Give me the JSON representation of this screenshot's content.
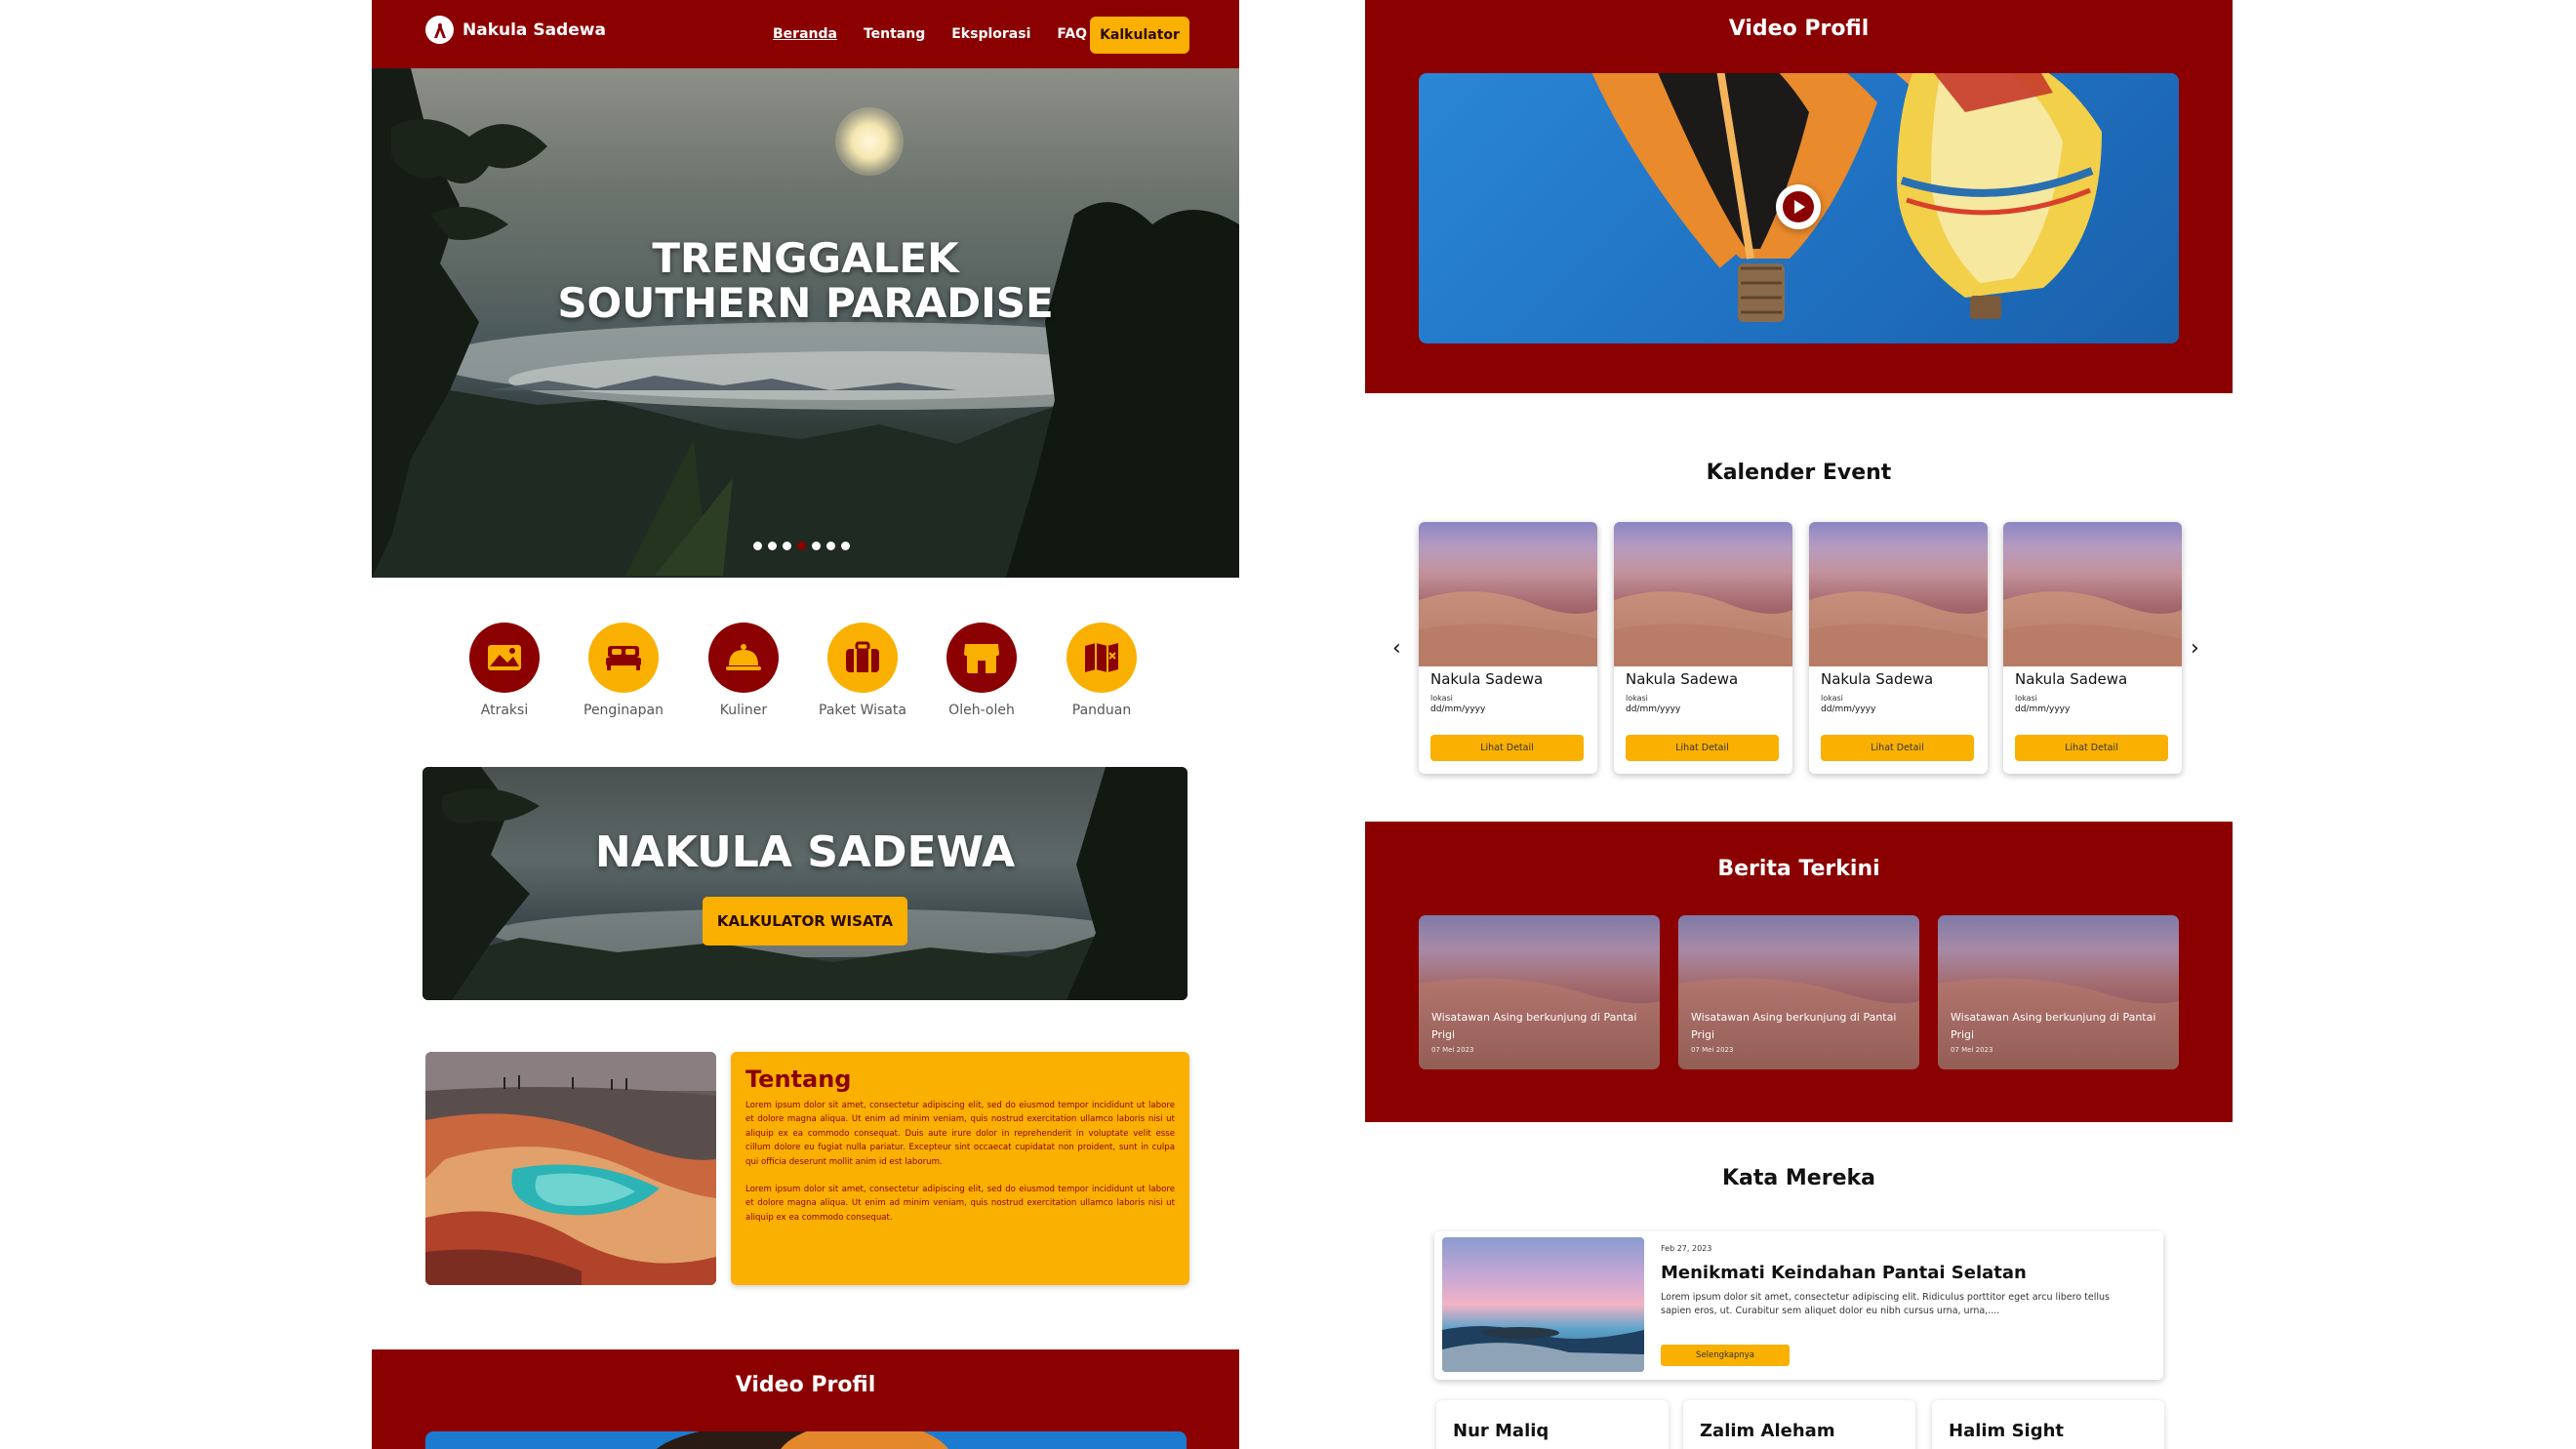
{
  "navbar": {
    "brand": "Nakula Sadewa",
    "links": [
      "Beranda",
      "Tentang",
      "Eksplorasi",
      "FAQ"
    ],
    "cta": "Kalkulator"
  },
  "hero": {
    "title_line1": "TRENGGALEK",
    "title_line2": "SOUTHERN PARADISE",
    "slide_count": 7,
    "active_slide": 4
  },
  "categories": [
    {
      "label": "Atraksi",
      "icon": "map-landscape-icon",
      "color": "red"
    },
    {
      "label": "Penginapan",
      "icon": "bed-icon",
      "color": "yellow"
    },
    {
      "label": "Kuliner",
      "icon": "food-cloche-icon",
      "color": "red"
    },
    {
      "label": "Paket Wisata",
      "icon": "suitcase-icon",
      "color": "yellow"
    },
    {
      "label": "Oleh-oleh",
      "icon": "shop-icon",
      "color": "red"
    },
    {
      "label": "Panduan",
      "icon": "folded-map-icon",
      "color": "yellow"
    }
  ],
  "banner": {
    "title": "NAKULA SADEWA",
    "button": "KALKULATOR WISATA"
  },
  "about": {
    "title": "Tentang",
    "paragraph1": "Lorem ipsum dolor sit amet, consectetur adipiscing elit, sed do eiusmod tempor incididunt ut labore et dolore magna aliqua. Ut enim ad minim veniam, quis nostrud exercitation ullamco laboris nisi ut aliquip ex ea commodo consequat. Duis aute irure dolor in reprehenderit in voluptate velit esse cillum dolore eu fugiat nulla pariatur. Excepteur sint occaecat cupidatat non proident, sunt in culpa qui officia deserunt mollit anim id est laborum.",
    "paragraph2": "Lorem ipsum dolor sit amet, consectetur adipiscing elit, sed do eiusmod tempor incididunt ut labore et dolore magna aliqua. Ut enim ad minim veniam, quis nostrud exercitation ullamco laboris nisi ut aliquip ex ea commodo consequat."
  },
  "video": {
    "title": "Video Profil"
  },
  "events": {
    "title": "Kalender Event",
    "cards": [
      {
        "name": "Nakula Sadewa",
        "location": "lokasi",
        "date": "dd/mm/yyyy",
        "button": "Lihat Detail"
      },
      {
        "name": "Nakula Sadewa",
        "location": "lokasi",
        "date": "dd/mm/yyyy",
        "button": "Lihat Detail"
      },
      {
        "name": "Nakula Sadewa",
        "location": "lokasi",
        "date": "dd/mm/yyyy",
        "button": "Lihat Detail"
      },
      {
        "name": "Nakula Sadewa",
        "location": "lokasi",
        "date": "dd/mm/yyyy",
        "button": "Lihat Detail"
      }
    ],
    "prev": "‹",
    "next": "›"
  },
  "news": {
    "title": "Berita Terkini",
    "cards": [
      {
        "headline": "Wisatawan Asing berkunjung di Pantai Prigi",
        "date": "07 Mei 2023"
      },
      {
        "headline": "Wisatawan Asing berkunjung di Pantai Prigi",
        "date": "07 Mei 2023"
      },
      {
        "headline": "Wisatawan Asing berkunjung di Pantai Prigi",
        "date": "07 Mei 2023"
      }
    ]
  },
  "testimonials": {
    "title": "Kata Mereka",
    "featured": {
      "date": "Feb 27, 2023",
      "title": "Menikmati Keindahan Pantai Selatan",
      "body": "Lorem ipsum dolor sit amet, consectetur adipiscing elit. Ridiculus porttitor eget arcu libero tellus sapien eros, ut. Curabitur sem aliquet dolor eu nibh cursus urna, urna,....",
      "button": "Selengkapnya"
    },
    "people": [
      "Nur Maliq",
      "Zalim Aleham",
      "Halim Sight"
    ]
  },
  "colors": {
    "primary_red": "#8b0000",
    "accent_yellow": "#f9b000"
  }
}
